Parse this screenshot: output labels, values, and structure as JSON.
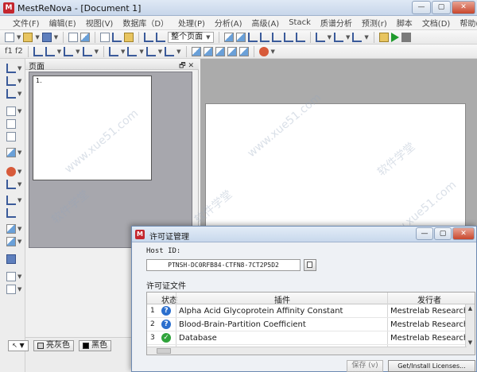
{
  "window": {
    "title": "MestReNova - [Document 1]",
    "app_icon_letter": "M",
    "minimize": "—",
    "maximize": "▢",
    "close": "✕"
  },
  "menu": {
    "items": [
      "文件(F)",
      "编辑(E)",
      "视图(V)",
      "数据库（D）",
      "处理(P)",
      "分析(A)",
      "高级(A)",
      "Stack",
      "质谱分析",
      "预测(r)",
      "脚本",
      "文档(D)",
      "帮助(H)"
    ]
  },
  "toolbar": {
    "page_select": "整个页面",
    "f1_label": "f1",
    "f2_label": "f2"
  },
  "pages_panel": {
    "title": "页面",
    "buttons": "🗗 ✕",
    "thumb_label": "1."
  },
  "bottom": {
    "fill_color": "亮灰色",
    "line_color": "黑色",
    "fill_swatch": "#d4d4d4",
    "line_swatch": "#000000"
  },
  "watermark_text": "www.xue51.com",
  "watermark_cn": "软件学堂",
  "dialog": {
    "title": "许可证管理",
    "host_id_label": "Host ID:",
    "host_id_value": "PTNSH-DC0RFB84-CTFN8-7CT2P5D2",
    "license_files_label": "许可证文件",
    "table": {
      "headers": {
        "status": "状态",
        "plugin": "插件",
        "issuer": "发行者"
      },
      "rows": [
        {
          "num": "1",
          "status": "question",
          "plugin": "Alpha Acid Glycoprotein Affinity Constant",
          "issuer": "Mestrelab Research S."
        },
        {
          "num": "2",
          "status": "question",
          "plugin": "Blood-Brain-Partition Coefficient",
          "issuer": "Mestrelab Research S."
        },
        {
          "num": "3",
          "status": "ok",
          "plugin": "Database",
          "issuer": "Mestrelab Research S."
        }
      ]
    },
    "save_button": "保存 (v)",
    "get_install_button": "Get/Install Licenses..."
  },
  "colors": {
    "brand_red": "#c4262e",
    "status_question": "#2b6fce",
    "status_ok": "#2fa33a",
    "run_green": "#1f9a2c"
  }
}
